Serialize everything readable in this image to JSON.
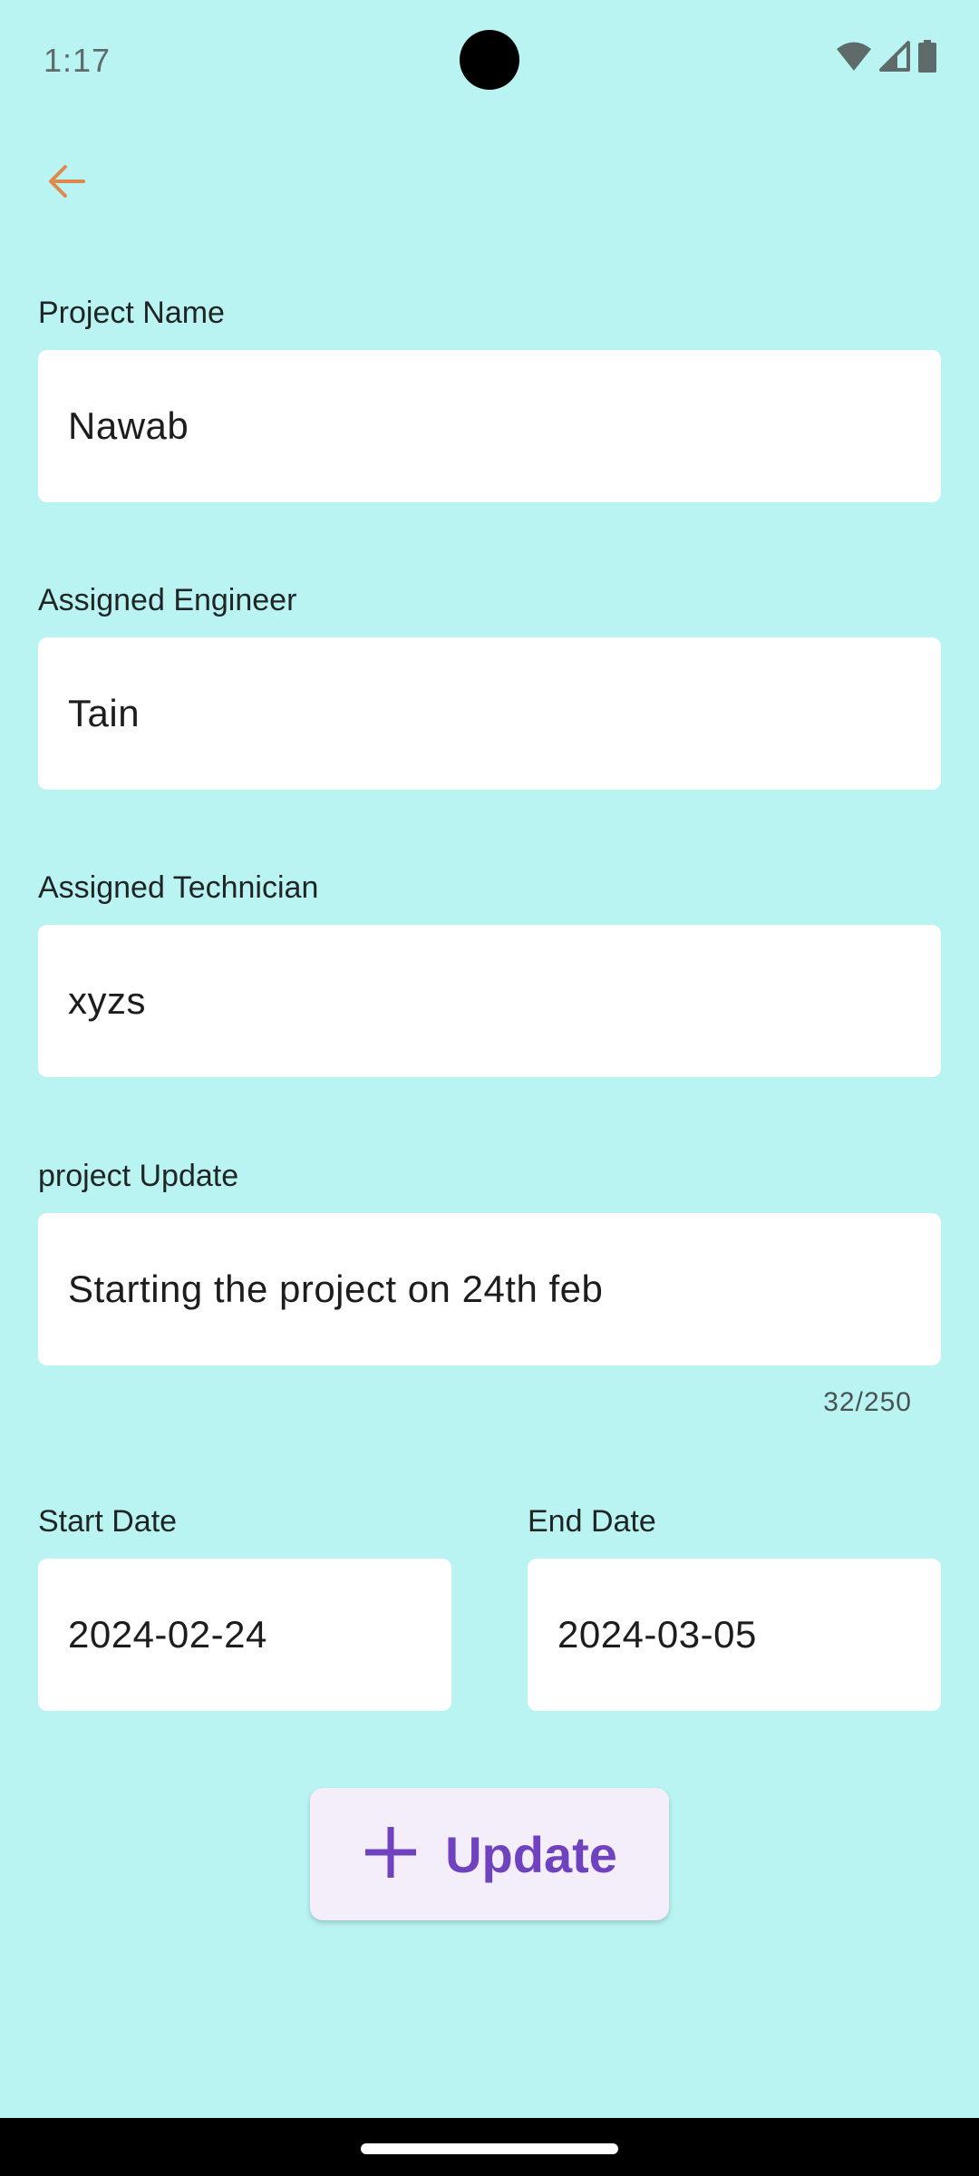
{
  "status_bar": {
    "time": "1:17",
    "icons": [
      "wifi-icon",
      "cellular-signal-icon",
      "battery-icon"
    ]
  },
  "header": {
    "back_icon": "arrow-back-icon",
    "back_color": "#e0894f"
  },
  "form": {
    "project_name": {
      "label": "Project Name",
      "value": "Nawab"
    },
    "assigned_engineer": {
      "label": "Assigned Engineer",
      "value": "Tain"
    },
    "assigned_technician": {
      "label": "Assigned Technician",
      "value": "xyzs"
    },
    "project_update": {
      "label": "project Update",
      "value": "Starting the project on 24th feb",
      "counter": "32/250"
    },
    "start_date": {
      "label": "Start Date",
      "value": "2024-02-24"
    },
    "end_date": {
      "label": "End Date",
      "value": "2024-03-05"
    }
  },
  "update_button": {
    "icon": "plus-icon",
    "label": "Update",
    "color": "#6f43c0",
    "background": "#f4eefb"
  },
  "colors": {
    "background": "#b9f4f2",
    "field_background": "#ffffff"
  }
}
